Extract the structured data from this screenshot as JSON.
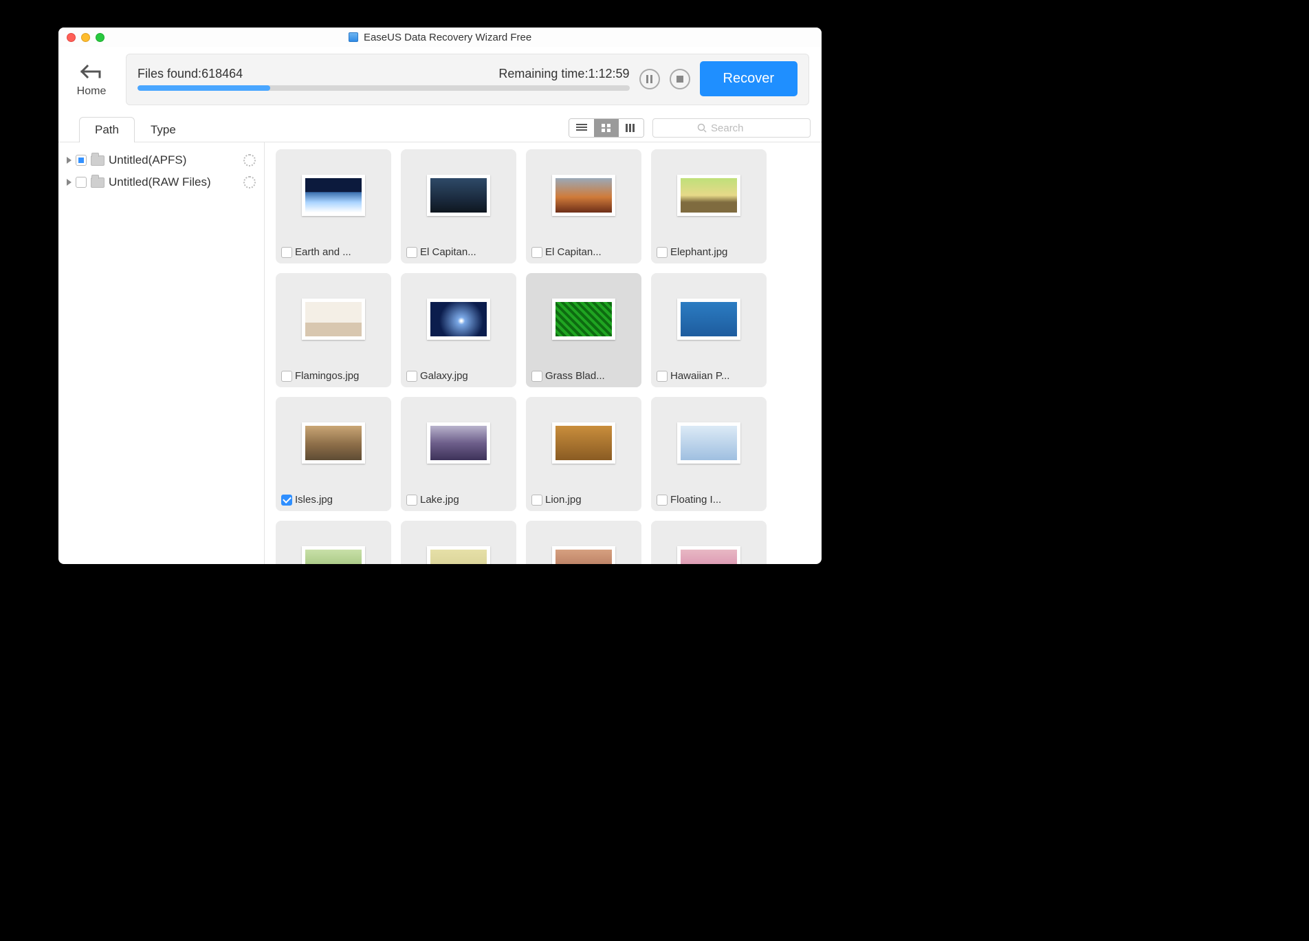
{
  "window": {
    "title": "EaseUS Data Recovery Wizard Free"
  },
  "home": {
    "label": "Home"
  },
  "progress": {
    "files_found_label": "Files found:",
    "files_found_value": "618464",
    "remaining_label": "Remaining time:",
    "remaining_value": "1:12:59",
    "percent": 27,
    "recover_label": "Recover"
  },
  "tabs": {
    "path": "Path",
    "type": "Type",
    "active": "path"
  },
  "search": {
    "placeholder": "Search"
  },
  "view": {
    "active": "grid"
  },
  "tree": [
    {
      "label": "Untitled(APFS)",
      "partial": true
    },
    {
      "label": "Untitled(RAW Files)",
      "partial": false
    }
  ],
  "files": [
    {
      "name": "Earth and ...",
      "checked": false,
      "selected": false,
      "thumb": "g-earth"
    },
    {
      "name": "El Capitan...",
      "checked": false,
      "selected": false,
      "thumb": "g-capitan-dark"
    },
    {
      "name": "El Capitan...",
      "checked": false,
      "selected": false,
      "thumb": "g-capitan"
    },
    {
      "name": "Elephant.jpg",
      "checked": false,
      "selected": false,
      "thumb": "g-elephant"
    },
    {
      "name": "Flamingos.jpg",
      "checked": false,
      "selected": false,
      "thumb": "g-flamingo"
    },
    {
      "name": "Galaxy.jpg",
      "checked": false,
      "selected": false,
      "thumb": "g-galaxy"
    },
    {
      "name": "Grass Blad...",
      "checked": false,
      "selected": true,
      "thumb": "g-grass"
    },
    {
      "name": "Hawaiian P...",
      "checked": false,
      "selected": false,
      "thumb": "g-hawaii"
    },
    {
      "name": "Isles.jpg",
      "checked": true,
      "selected": false,
      "thumb": "g-isles"
    },
    {
      "name": "Lake.jpg",
      "checked": false,
      "selected": false,
      "thumb": "g-lake"
    },
    {
      "name": "Lion.jpg",
      "checked": false,
      "selected": false,
      "thumb": "g-lion"
    },
    {
      "name": "Floating I...",
      "checked": false,
      "selected": false,
      "thumb": "g-ice"
    },
    {
      "name": "",
      "checked": false,
      "selected": false,
      "thumb": "g-plain4"
    },
    {
      "name": "",
      "checked": false,
      "selected": false,
      "thumb": "g-plain"
    },
    {
      "name": "",
      "checked": false,
      "selected": false,
      "thumb": "g-plain2"
    },
    {
      "name": "",
      "checked": false,
      "selected": false,
      "thumb": "g-plain3"
    }
  ]
}
